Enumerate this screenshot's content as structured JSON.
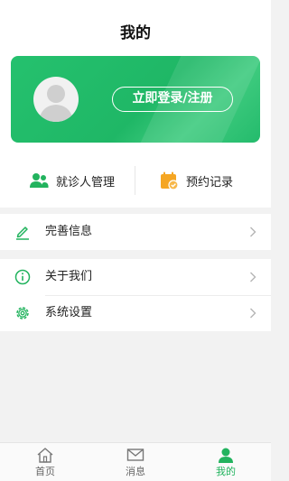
{
  "header": {
    "title": "我的"
  },
  "profile": {
    "login_label": "立即登录/注册"
  },
  "quick_actions": [
    {
      "label": "就诊人管理",
      "icon": "patients-icon"
    },
    {
      "label": "预约记录",
      "icon": "appointment-icon"
    }
  ],
  "menu": {
    "profile_info": {
      "label": "完善信息",
      "icon": "edit-icon"
    },
    "about": {
      "label": "关于我们",
      "icon": "info-icon"
    },
    "settings": {
      "label": "系统设置",
      "icon": "gear-icon"
    }
  },
  "tabbar": {
    "items": [
      {
        "label": "首页",
        "icon": "home-icon"
      },
      {
        "label": "消息",
        "icon": "mail-icon"
      },
      {
        "label": "我的",
        "icon": "user-icon",
        "active": true
      }
    ]
  },
  "colors": {
    "accent": "#22b35e",
    "card": "#23bd6b",
    "orange": "#f5a623",
    "background": "#f2f2f2"
  }
}
